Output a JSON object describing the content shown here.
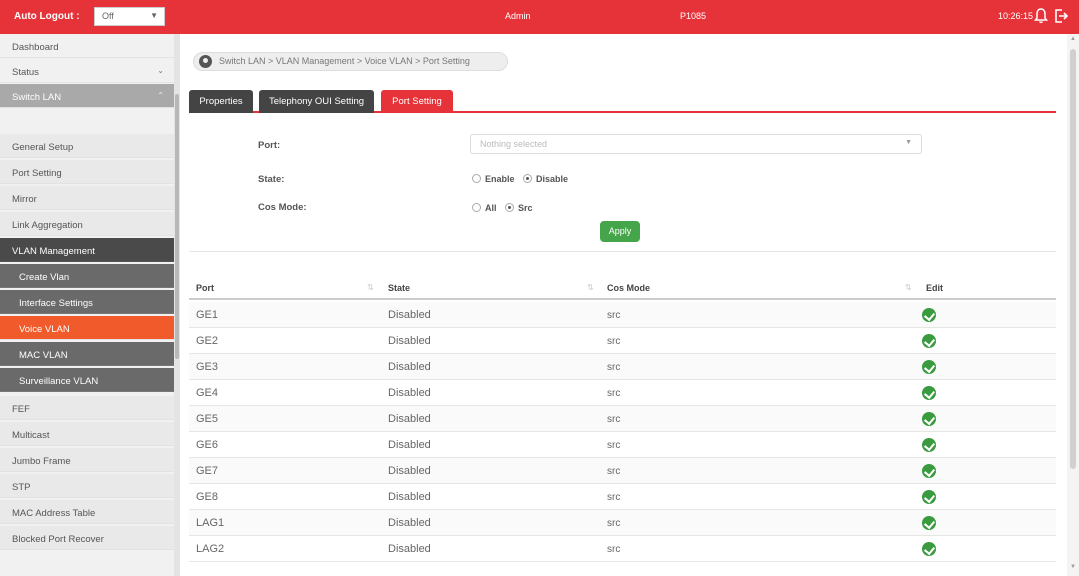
{
  "topbar": {
    "auto_logout_label": "Auto Logout :",
    "auto_logout_value": "Off",
    "user": "Admin",
    "model": "P1085",
    "time": "10:26:15",
    "accent_color": "#e6333a",
    "bell_icon": "bell-icon",
    "logout_icon": "logout-icon"
  },
  "sidebar": {
    "items": [
      {
        "label": "Dashboard"
      },
      {
        "label": "Status"
      },
      {
        "label": "Switch LAN"
      },
      {
        "label": "General Setup"
      },
      {
        "label": "Port Setting"
      },
      {
        "label": "Mirror"
      },
      {
        "label": "Link Aggregation"
      },
      {
        "label": "VLAN Management"
      },
      {
        "label": "Create Vlan"
      },
      {
        "label": "Interface Settings"
      },
      {
        "label": "Voice VLAN"
      },
      {
        "label": "MAC VLAN"
      },
      {
        "label": "Surveillance VLAN"
      },
      {
        "label": "FEF"
      },
      {
        "label": "Multicast"
      },
      {
        "label": "Jumbo Frame"
      },
      {
        "label": "STP"
      },
      {
        "label": "MAC Address Table"
      },
      {
        "label": "Blocked Port Recover"
      }
    ]
  },
  "breadcrumb": "Switch LAN > VLAN Management > Voice VLAN > Port Setting",
  "tabs": [
    {
      "label": "Properties"
    },
    {
      "label": "Telephony OUI Setting"
    },
    {
      "label": "Port Setting"
    }
  ],
  "form": {
    "port_label": "Port:",
    "port_placeholder": "Nothing selected",
    "state_label": "State:",
    "state_enable": "Enable",
    "state_disable": "Disable",
    "cos_label": "Cos Mode:",
    "cos_all": "All",
    "cos_src": "Src",
    "apply": "Apply"
  },
  "table": {
    "headers": {
      "port": "Port",
      "state": "State",
      "cos": "Cos Mode",
      "edit": "Edit"
    },
    "rows": [
      {
        "port": "GE1",
        "state": "Disabled",
        "cos": "src"
      },
      {
        "port": "GE2",
        "state": "Disabled",
        "cos": "src"
      },
      {
        "port": "GE3",
        "state": "Disabled",
        "cos": "src"
      },
      {
        "port": "GE4",
        "state": "Disabled",
        "cos": "src"
      },
      {
        "port": "GE5",
        "state": "Disabled",
        "cos": "src"
      },
      {
        "port": "GE6",
        "state": "Disabled",
        "cos": "src"
      },
      {
        "port": "GE7",
        "state": "Disabled",
        "cos": "src"
      },
      {
        "port": "GE8",
        "state": "Disabled",
        "cos": "src"
      },
      {
        "port": "LAG1",
        "state": "Disabled",
        "cos": "src"
      },
      {
        "port": "LAG2",
        "state": "Disabled",
        "cos": "src"
      }
    ]
  }
}
